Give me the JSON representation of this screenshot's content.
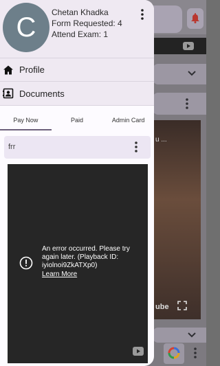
{
  "user": {
    "avatar_letter": "C",
    "name": "Chetan Khadka",
    "form_requested": "Form Requested: 4",
    "attend_exam": "Attend Exam: 1"
  },
  "nav": {
    "profile_label": "Profile",
    "documents_label": "Documents"
  },
  "tabs": [
    "Pay Now",
    "Paid",
    "Admin Card"
  ],
  "card": {
    "title": "frr"
  },
  "player": {
    "error_message": "An error occurred. Please try again later. (Playback ID: iyiolnoi9ZkATXp0)",
    "link_text": "Learn More"
  },
  "background": {
    "video_fragment": "u ...",
    "youtube_fragment": "ube"
  },
  "colors": {
    "drawer_bg": "#fdfbff",
    "header_bg": "#efe9f2",
    "avatar_bg": "#6d7f8a",
    "tab_indicator": "#6b5f7a",
    "player_bg": "#262626",
    "bell_color": "#c62828"
  },
  "icons": {
    "header_menu": "more-vert-icon",
    "profile": "home-icon",
    "documents": "contact-card-icon",
    "card_menu": "more-vert-icon",
    "error": "error-icon",
    "player_logo": "youtube-icon"
  }
}
